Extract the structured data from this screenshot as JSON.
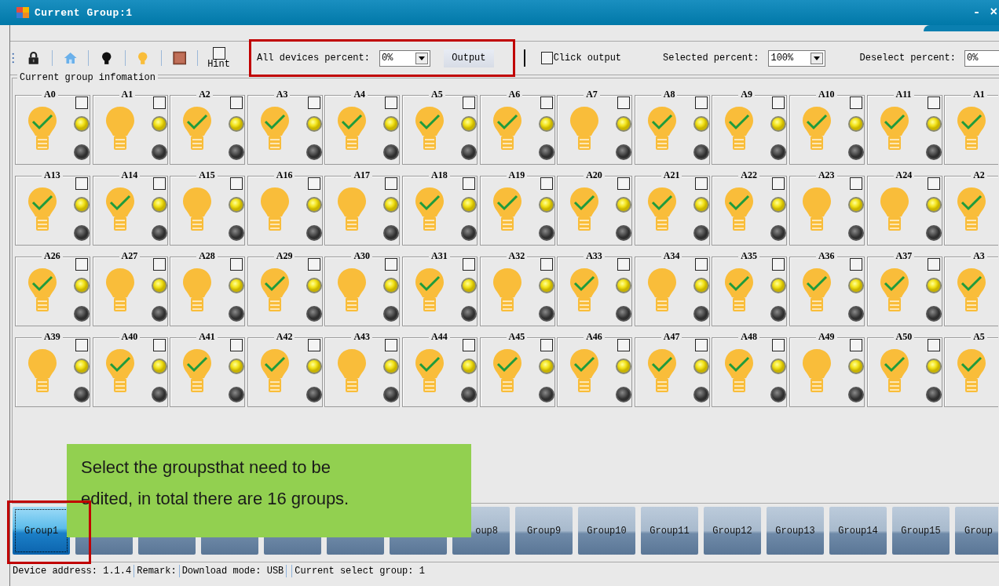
{
  "window": {
    "title": "Current Group:1",
    "controls": [
      "-",
      "×"
    ]
  },
  "toolbar": {
    "hint": {
      "label": "Hint",
      "checked": false
    },
    "all_devices": {
      "label": "All devices percent:",
      "value": "0%"
    },
    "output_button": "Output",
    "click_output": {
      "label": "Click output",
      "checked": false
    },
    "selected_percent": {
      "label": "Selected percent:",
      "value": "100%"
    },
    "deselect_percent": {
      "label": "Deselect percent:",
      "value": "0%"
    }
  },
  "group_info": {
    "title": "Current group infomation",
    "devices": [
      {
        "label": "A0",
        "active": true,
        "checked": false
      },
      {
        "label": "A1",
        "active": false,
        "checked": false
      },
      {
        "label": "A2",
        "active": true,
        "checked": false
      },
      {
        "label": "A3",
        "active": true,
        "checked": false
      },
      {
        "label": "A4",
        "active": true,
        "checked": false
      },
      {
        "label": "A5",
        "active": true,
        "checked": false
      },
      {
        "label": "A6",
        "active": true,
        "checked": false
      },
      {
        "label": "A7",
        "active": false,
        "checked": false
      },
      {
        "label": "A8",
        "active": true,
        "checked": false
      },
      {
        "label": "A9",
        "active": true,
        "checked": false
      },
      {
        "label": "A10",
        "active": true,
        "checked": false
      },
      {
        "label": "A11",
        "active": true,
        "checked": false
      },
      {
        "label": "A1",
        "active": true
      },
      {
        "label": "A13",
        "active": true,
        "checked": false
      },
      {
        "label": "A14",
        "active": true,
        "checked": false
      },
      {
        "label": "A15",
        "active": false,
        "checked": false
      },
      {
        "label": "A16",
        "active": false,
        "checked": false
      },
      {
        "label": "A17",
        "active": false,
        "checked": false
      },
      {
        "label": "A18",
        "active": true,
        "checked": false
      },
      {
        "label": "A19",
        "active": true,
        "checked": false
      },
      {
        "label": "A20",
        "active": true,
        "checked": false
      },
      {
        "label": "A21",
        "active": true,
        "checked": false
      },
      {
        "label": "A22",
        "active": true,
        "checked": false
      },
      {
        "label": "A23",
        "active": false,
        "checked": false
      },
      {
        "label": "A24",
        "active": false,
        "checked": false
      },
      {
        "label": "A2",
        "active": true
      },
      {
        "label": "A26",
        "active": true,
        "checked": false
      },
      {
        "label": "A27",
        "active": false,
        "checked": false
      },
      {
        "label": "A28",
        "active": false,
        "checked": false
      },
      {
        "label": "A29",
        "active": true,
        "checked": false
      },
      {
        "label": "A30",
        "active": false,
        "checked": false
      },
      {
        "label": "A31",
        "active": true,
        "checked": false
      },
      {
        "label": "A32",
        "active": false,
        "checked": false
      },
      {
        "label": "A33",
        "active": true,
        "checked": false
      },
      {
        "label": "A34",
        "active": false,
        "checked": false
      },
      {
        "label": "A35",
        "active": true,
        "checked": false
      },
      {
        "label": "A36",
        "active": true,
        "checked": false
      },
      {
        "label": "A37",
        "active": true,
        "checked": false
      },
      {
        "label": "A3",
        "active": true
      },
      {
        "label": "A39",
        "active": false,
        "checked": false
      },
      {
        "label": "A40",
        "active": true,
        "checked": false
      },
      {
        "label": "A41",
        "active": true,
        "checked": false
      },
      {
        "label": "A42",
        "active": true,
        "checked": false
      },
      {
        "label": "A43",
        "active": false,
        "checked": false
      },
      {
        "label": "A44",
        "active": true,
        "checked": false
      },
      {
        "label": "A45",
        "active": true,
        "checked": false
      },
      {
        "label": "A46",
        "active": true,
        "checked": false
      },
      {
        "label": "A47",
        "active": true,
        "checked": false
      },
      {
        "label": "A48",
        "active": true,
        "checked": false
      },
      {
        "label": "A49",
        "active": false,
        "checked": false
      },
      {
        "label": "A50",
        "active": true,
        "checked": false
      },
      {
        "label": "A5",
        "active": true
      }
    ]
  },
  "group_tabs": [
    {
      "label": "Group1",
      "selected": true
    },
    {
      "selected": false
    },
    {
      "selected": false
    },
    {
      "selected": false
    },
    {
      "selected": false
    },
    {
      "selected": false
    },
    {
      "selected": false
    },
    {
      "label": "oup8",
      "selected": false
    },
    {
      "label": "Group9",
      "selected": false
    },
    {
      "label": "Group10",
      "selected": false
    },
    {
      "label": "Group11",
      "selected": false
    },
    {
      "label": "Group12",
      "selected": false
    },
    {
      "label": "Group13",
      "selected": false
    },
    {
      "label": "Group14",
      "selected": false
    },
    {
      "label": "Group15",
      "selected": false
    },
    {
      "label": "Group",
      "selected": false
    }
  ],
  "callout": {
    "lines": [
      "Select the groupsthat need to be",
      "edited, in total there are 16 groups."
    ]
  },
  "status_bar": [
    {
      "kind": "text",
      "text": "Device address: 1.1.4"
    },
    {
      "kind": "text",
      "text": "Remark:"
    },
    {
      "kind": "text",
      "text": "Download mode: USB"
    },
    {
      "kind": "gap"
    },
    {
      "kind": "text",
      "text": "Current select group: 1"
    }
  ]
}
